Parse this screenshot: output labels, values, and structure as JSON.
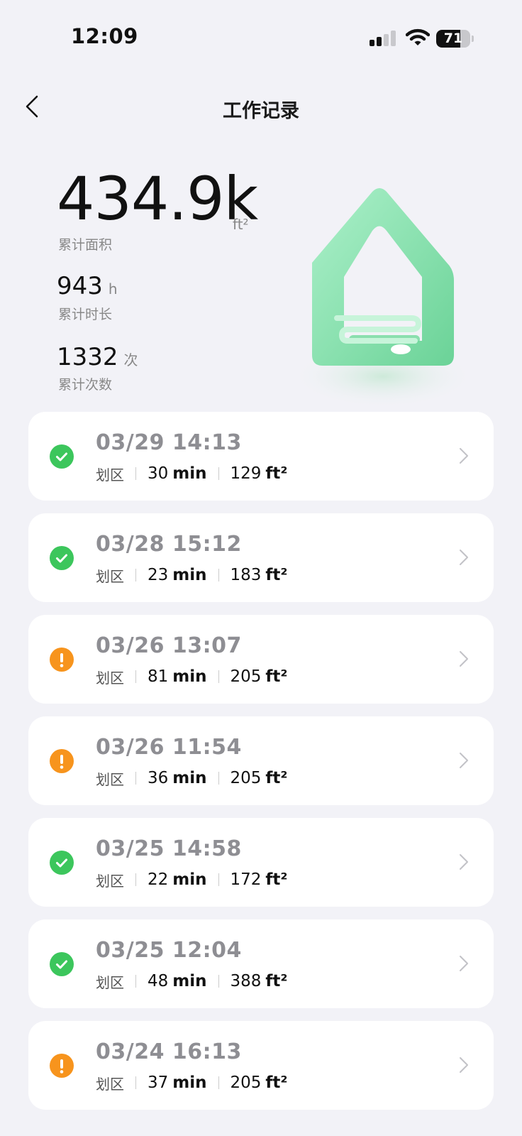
{
  "status_bar": {
    "time": "12:09",
    "battery": "71",
    "battery_level": 0.71
  },
  "nav": {
    "title": "工作记录"
  },
  "summary": {
    "total_area": "434.9k",
    "total_area_unit": "ft²",
    "total_area_label": "累计面积",
    "total_duration": "943",
    "total_duration_unit": "h",
    "total_duration_label": "累计时长",
    "total_count": "1332",
    "total_count_unit": "次",
    "total_count_label": "累计次数"
  },
  "colors": {
    "ok": "#3cc65c",
    "warn": "#f7941d",
    "house": "#7fe0a8"
  },
  "records": [
    {
      "status": "ok",
      "datetime": "03/29  14:13",
      "mode": "划区",
      "duration": "30",
      "duration_unit": "min",
      "area": "129",
      "area_unit": "ft²"
    },
    {
      "status": "ok",
      "datetime": "03/28  15:12",
      "mode": "划区",
      "duration": "23",
      "duration_unit": "min",
      "area": "183",
      "area_unit": "ft²"
    },
    {
      "status": "warn",
      "datetime": "03/26  13:07",
      "mode": "划区",
      "duration": "81",
      "duration_unit": "min",
      "area": "205",
      "area_unit": "ft²"
    },
    {
      "status": "warn",
      "datetime": "03/26  11:54",
      "mode": "划区",
      "duration": "36",
      "duration_unit": "min",
      "area": "205",
      "area_unit": "ft²"
    },
    {
      "status": "ok",
      "datetime": "03/25  14:58",
      "mode": "划区",
      "duration": "22",
      "duration_unit": "min",
      "area": "172",
      "area_unit": "ft²"
    },
    {
      "status": "ok",
      "datetime": "03/25  12:04",
      "mode": "划区",
      "duration": "48",
      "duration_unit": "min",
      "area": "388",
      "area_unit": "ft²"
    },
    {
      "status": "warn",
      "datetime": "03/24  16:13",
      "mode": "划区",
      "duration": "37",
      "duration_unit": "min",
      "area": "205",
      "area_unit": "ft²"
    }
  ]
}
